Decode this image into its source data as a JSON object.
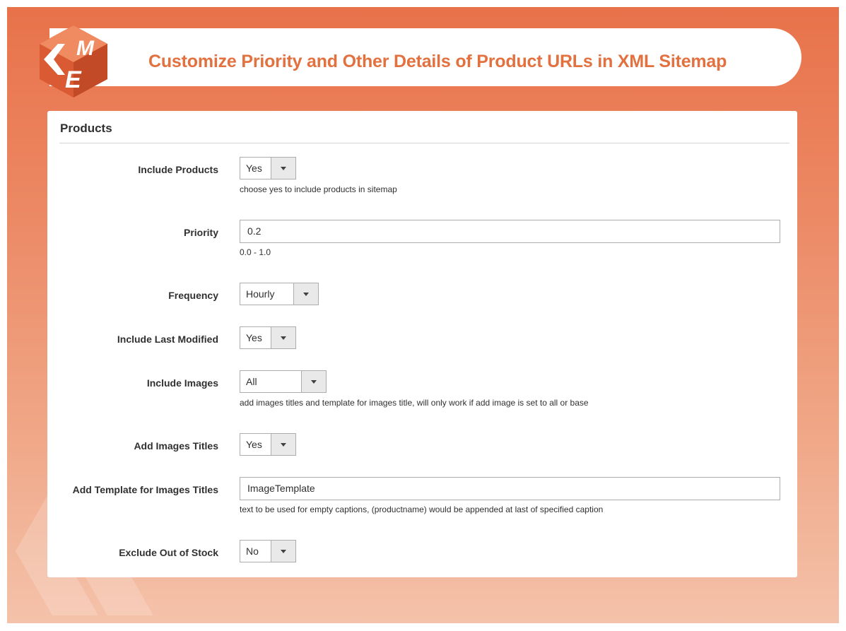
{
  "banner": {
    "title": "Customize Priority and Other Details of Product URLs in XML Sitemap",
    "logo_text": "FME",
    "accent_color": "#e2713f",
    "background_color": "#e8724a"
  },
  "panel": {
    "title": "Products",
    "fields": [
      {
        "label": "Include Products",
        "type": "select",
        "value": "Yes",
        "note": "choose yes to include products in sitemap"
      },
      {
        "label": "Priority",
        "type": "input",
        "value": "0.2",
        "note": "0.0 - 1.0"
      },
      {
        "label": "Frequency",
        "type": "select",
        "value": "Hourly",
        "note": ""
      },
      {
        "label": "Include Last Modified",
        "type": "select",
        "value": "Yes",
        "note": ""
      },
      {
        "label": "Include Images",
        "type": "select",
        "value": "All",
        "note": "add images titles and template for images title, will only work if add image is set to all or base"
      },
      {
        "label": "Add Images Titles",
        "type": "select",
        "value": "Yes",
        "note": ""
      },
      {
        "label": "Add Template for Images Titles",
        "type": "input",
        "value": "ImageTemplate",
        "note": "text to be used for empty captions, (productname) would be appended at last of specified caption"
      },
      {
        "label": "Exclude Out of Stock",
        "type": "select",
        "value": "No",
        "note": ""
      }
    ]
  }
}
